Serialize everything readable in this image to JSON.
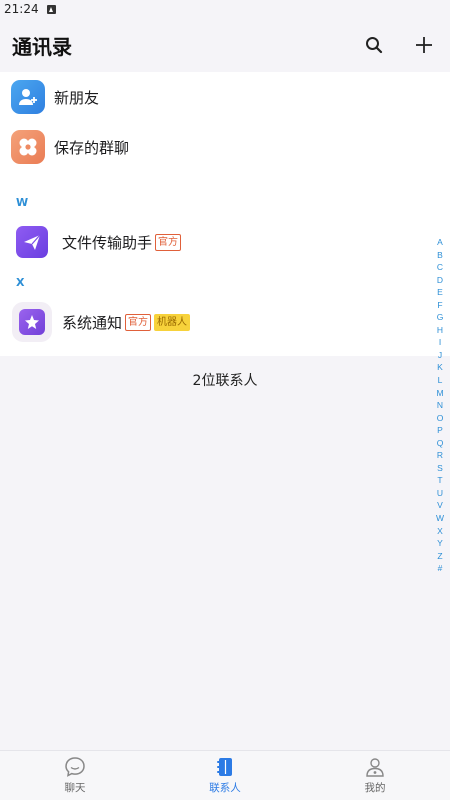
{
  "status_bar": {
    "time": "21:24"
  },
  "header": {
    "title": "通讯录"
  },
  "top_items": [
    {
      "label": "新朋友",
      "icon": "add-user-icon"
    },
    {
      "label": "保存的群聊",
      "icon": "group-clover-icon"
    }
  ],
  "sections": [
    {
      "letter": "W",
      "contacts": [
        {
          "name": "文件传输助手",
          "tags": [
            "官方"
          ]
        }
      ]
    },
    {
      "letter": "X",
      "contacts": [
        {
          "name": "系统通知",
          "tags": [
            "官方",
            "机器人"
          ]
        }
      ]
    }
  ],
  "contact_count": "2位联系人",
  "index_letters": [
    "A",
    "B",
    "C",
    "D",
    "E",
    "F",
    "G",
    "H",
    "I",
    "J",
    "K",
    "L",
    "M",
    "N",
    "O",
    "P",
    "Q",
    "R",
    "S",
    "T",
    "U",
    "V",
    "W",
    "X",
    "Y",
    "Z",
    "#"
  ],
  "tabs": [
    {
      "label": "聊天",
      "icon": "chat-bubble-icon",
      "active": false
    },
    {
      "label": "联系人",
      "icon": "contacts-book-icon",
      "active": true
    },
    {
      "label": "我的",
      "icon": "profile-icon",
      "active": false
    }
  ],
  "colors": {
    "accent": "#2c7be5",
    "index_letter": "#2d8fd6",
    "tag_official": "#e0603a",
    "tag_bot_bg": "#f7d23b"
  }
}
